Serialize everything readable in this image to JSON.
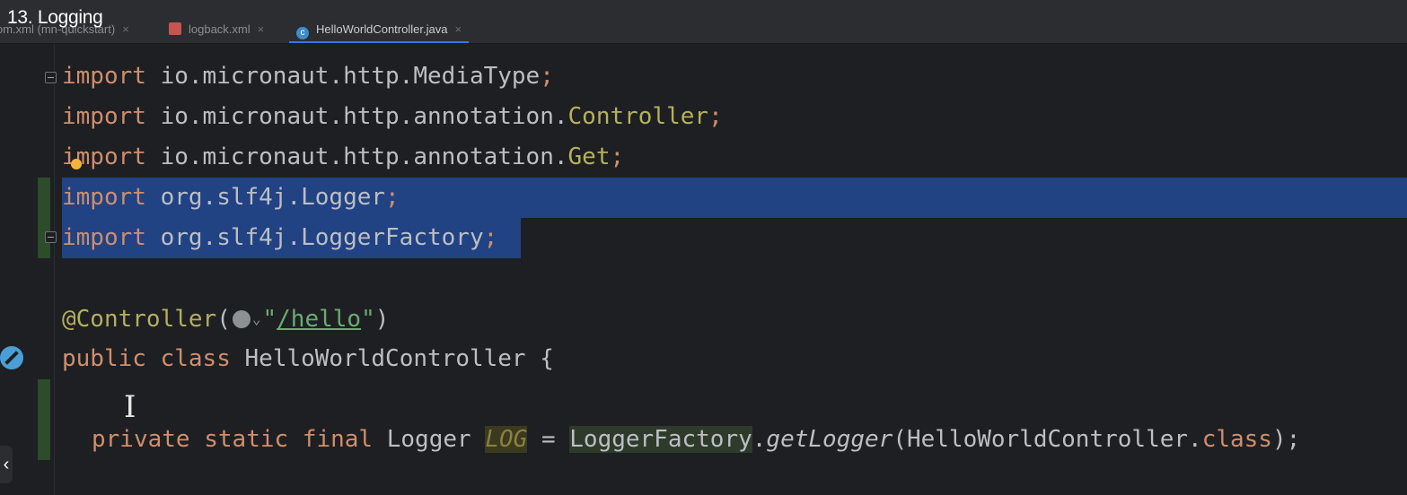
{
  "overlay_title": "13. Logging",
  "tabs": [
    {
      "label": "om.xml (mn-quickstart)",
      "active": false
    },
    {
      "label": "logback.xml",
      "active": false
    },
    {
      "label": "HelloWorldController.java",
      "active": true
    }
  ],
  "code": {
    "line1_kw": "import",
    "line1_rest": " io.micronaut.http.MediaType",
    "line1_end": ";",
    "line2_kw": "import",
    "line2_pkg": " io.micronaut.http.annotation.",
    "line2_cls": "Controller",
    "line2_end": ";",
    "line3_kw": "import",
    "line3_pkg": " io.micronaut.http.annotation.",
    "line3_cls": "Get",
    "line3_end": ";",
    "line4_kw": "import",
    "line4_rest": " org.slf4j.Logger",
    "line4_end": ";",
    "line5_kw": "import",
    "line5_rest": " org.slf4j.LoggerFactory",
    "line5_end": ";",
    "line6_ann": "@Controller",
    "line6_open": "(",
    "line6_q1": "\"",
    "line6_url": "/hello",
    "line6_q2": "\"",
    "line6_close": ")",
    "line7_kw1": "public",
    "line7_kw2": "class",
    "line7_name": " HelloWorldController {",
    "line8_kw1": "private",
    "line8_kw2": "static",
    "line8_kw3": "final",
    "line8_type": " Logger ",
    "line8_field": "LOG",
    "line8_eq": " = ",
    "line8_factory": "LoggerFactory",
    "line8_dot": ".",
    "line8_method": "getLogger",
    "line8_arg": "(HelloWorldController.",
    "line8_class": "class",
    "line8_end": ");"
  },
  "colors": {
    "keyword": "#cf8e6d",
    "annotation": "#b3ae60",
    "string": "#6aab73",
    "selection": "#214283"
  },
  "icons": [
    "lightbulb-icon",
    "spring-bean-icon",
    "globe-icon",
    "fold-icon",
    "text-cursor-icon"
  ],
  "nav": {
    "left_arrow": "‹"
  }
}
